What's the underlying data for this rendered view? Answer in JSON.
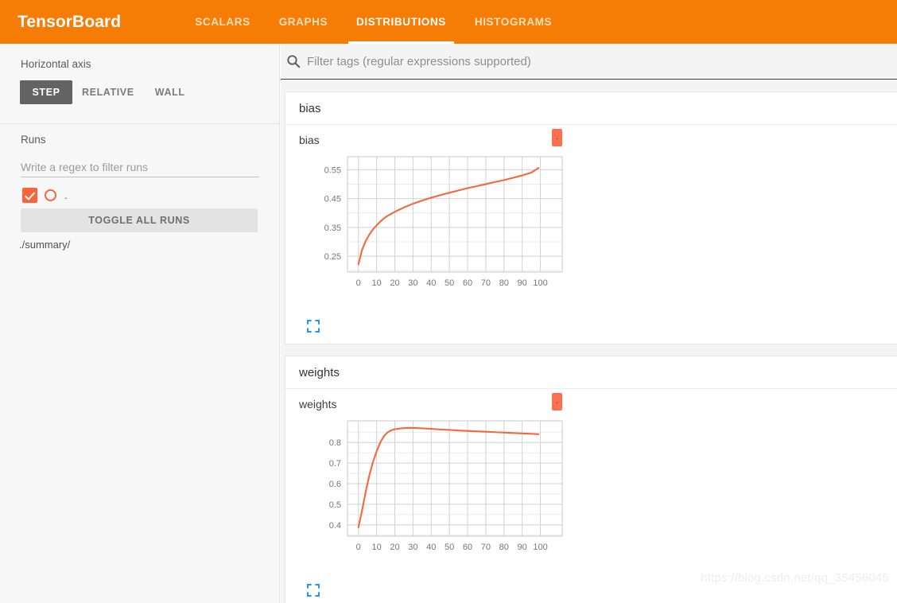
{
  "header": {
    "brand": "TensorBoard",
    "tabs": [
      {
        "label": "SCALARS",
        "active": false
      },
      {
        "label": "GRAPHS",
        "active": false
      },
      {
        "label": "DISTRIBUTIONS",
        "active": true
      },
      {
        "label": "HISTOGRAMS",
        "active": false
      }
    ]
  },
  "sidebar": {
    "horizontal_axis_label": "Horizontal axis",
    "axis_buttons": [
      {
        "label": "STEP",
        "active": true
      },
      {
        "label": "RELATIVE",
        "active": false
      },
      {
        "label": "WALL",
        "active": false
      }
    ],
    "runs_label": "Runs",
    "runs_filter_placeholder": "Write a regex to filter runs",
    "runs_filter_value": "",
    "run_entry_label": ".",
    "toggle_all_label": "TOGGLE ALL RUNS",
    "summary_path": "./summary/"
  },
  "main": {
    "filter_placeholder": "Filter tags (regular expressions supported)",
    "filter_value": "",
    "groups": [
      {
        "name": "bias",
        "chart_index": 0
      },
      {
        "name": "weights",
        "chart_index": 1
      }
    ]
  },
  "watermark": "https://blog.csdn.net/qq_35456045",
  "colors": {
    "brand_orange": "#F57C05",
    "accent_orange": "#F9643F",
    "line_orange": "#F4693C",
    "badge_orange": "#FA7050",
    "expand_blue": "#2196F3",
    "active_button_gray": "#636363"
  },
  "chart_data": [
    {
      "type": "line",
      "title": "bias",
      "run_badge_label": ".",
      "xlabel": "",
      "ylabel": "",
      "xlim": [
        -6,
        112
      ],
      "ylim": [
        0.195,
        0.595
      ],
      "xticks": [
        0,
        10,
        20,
        30,
        40,
        50,
        60,
        70,
        80,
        90,
        100
      ],
      "xtick_labels": [
        "0",
        "10",
        "20",
        "30",
        "40",
        "50",
        "60",
        "70",
        "80",
        "90",
        "100"
      ],
      "yticks": [
        0.25,
        0.35,
        0.45,
        0.55
      ],
      "ytick_labels": [
        "0.25",
        "0.35",
        "0.45",
        "0.55"
      ],
      "yminor": [
        0.2,
        0.3,
        0.4,
        0.5
      ],
      "grid": true,
      "legend": "none",
      "series": [
        {
          "name": ".",
          "color": "#F4693C",
          "x": [
            0,
            2,
            4,
            6,
            8,
            10,
            12,
            14,
            16,
            18,
            20,
            25,
            30,
            35,
            40,
            45,
            50,
            55,
            60,
            65,
            70,
            75,
            80,
            85,
            90,
            95,
            99
          ],
          "y": [
            0.222,
            0.272,
            0.303,
            0.325,
            0.343,
            0.357,
            0.37,
            0.381,
            0.39,
            0.397,
            0.404,
            0.419,
            0.432,
            0.443,
            0.453,
            0.462,
            0.47,
            0.478,
            0.486,
            0.493,
            0.5,
            0.507,
            0.514,
            0.522,
            0.53,
            0.54,
            0.556
          ]
        }
      ]
    },
    {
      "type": "line",
      "title": "weights",
      "run_badge_label": ".",
      "xlabel": "",
      "ylabel": "",
      "xlim": [
        -6,
        112
      ],
      "ylim": [
        0.345,
        0.905
      ],
      "xticks": [
        0,
        10,
        20,
        30,
        40,
        50,
        60,
        70,
        80,
        90,
        100
      ],
      "xtick_labels": [
        "0",
        "10",
        "20",
        "30",
        "40",
        "50",
        "60",
        "70",
        "80",
        "90",
        "100"
      ],
      "yticks": [
        0.4,
        0.5,
        0.6,
        0.7,
        0.8
      ],
      "ytick_labels": [
        "0.4",
        "0.5",
        "0.6",
        "0.7",
        "0.8"
      ],
      "yminor": [
        0.35,
        0.45,
        0.55,
        0.65,
        0.75,
        0.85
      ],
      "grid": true,
      "legend": "none",
      "series": [
        {
          "name": ".",
          "color": "#F4693C",
          "x": [
            0,
            2,
            4,
            6,
            8,
            10,
            12,
            14,
            16,
            18,
            20,
            24,
            28,
            32,
            36,
            40,
            45,
            50,
            55,
            60,
            65,
            70,
            75,
            80,
            85,
            90,
            95,
            99
          ],
          "y": [
            0.388,
            0.47,
            0.56,
            0.64,
            0.705,
            0.757,
            0.8,
            0.83,
            0.849,
            0.859,
            0.864,
            0.869,
            0.871,
            0.87,
            0.868,
            0.866,
            0.863,
            0.861,
            0.858,
            0.856,
            0.854,
            0.852,
            0.85,
            0.848,
            0.846,
            0.844,
            0.842,
            0.84
          ]
        }
      ]
    }
  ]
}
